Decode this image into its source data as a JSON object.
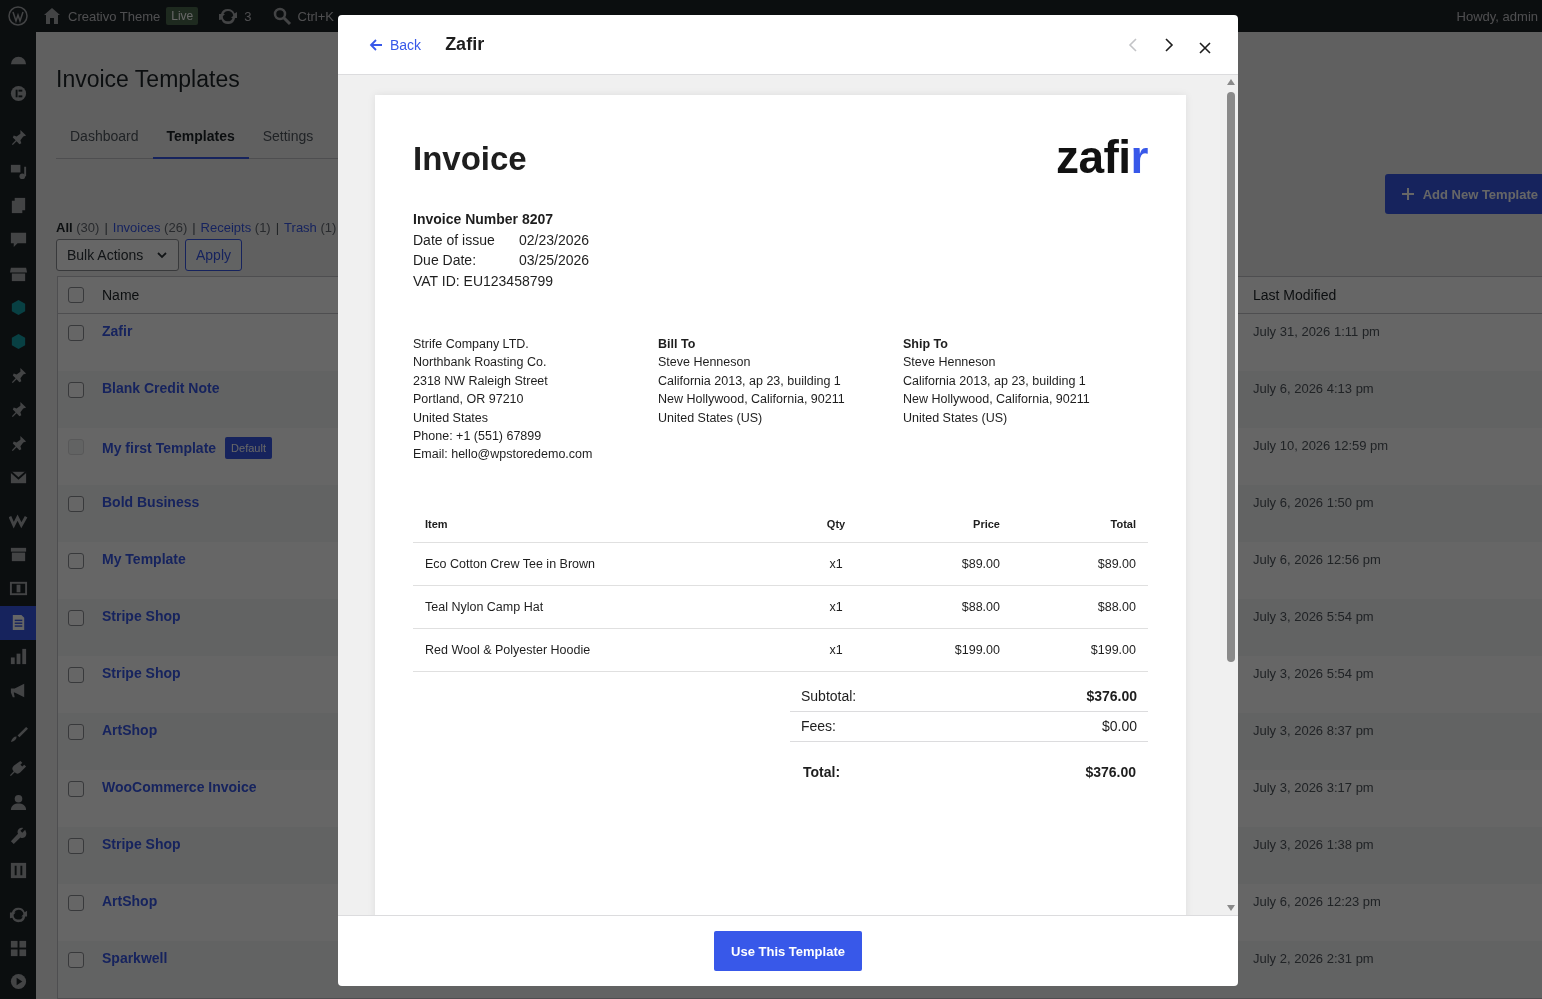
{
  "admin_bar": {
    "site": "Creativo Theme",
    "live_badge": "Live",
    "updates": "3",
    "search_shortcut": "Ctrl+K",
    "greeting": "Howdy, admin"
  },
  "sidebar": {
    "items": [
      {
        "selected": false
      },
      {
        "selected": false
      },
      {
        "selected": false
      },
      {
        "selected": false
      },
      {
        "selected": false
      },
      {
        "selected": false
      },
      {
        "selected": false
      },
      {
        "selected": false
      },
      {
        "selected": false
      },
      {
        "selected": false
      },
      {
        "selected": false
      },
      {
        "selected": false
      },
      {
        "selected": false
      },
      {
        "selected": false
      },
      {
        "selected": false
      },
      {
        "selected": false
      },
      {
        "selected": true
      },
      {
        "selected": false
      },
      {
        "selected": false
      },
      {
        "selected": false
      },
      {
        "selected": false
      },
      {
        "selected": false
      },
      {
        "selected": false
      },
      {
        "selected": false
      },
      {
        "selected": false
      },
      {
        "selected": false
      },
      {
        "selected": false
      }
    ]
  },
  "page": {
    "title": "Invoice Templates",
    "tabs": [
      {
        "label": "Dashboard",
        "selected": false
      },
      {
        "label": "Templates",
        "selected": true
      },
      {
        "label": "Settings",
        "selected": false
      }
    ],
    "add_button": "Add New Template",
    "filter_separator": "|",
    "filters": [
      {
        "label": "All",
        "count": "(30)",
        "selected": true
      },
      {
        "label": "Invoices",
        "count": "(26)",
        "selected": false
      },
      {
        "label": "Receipts",
        "count": "(1)",
        "selected": false
      },
      {
        "label": "Trash",
        "count": "(1)",
        "selected": false
      }
    ],
    "bulk_actions": "Bulk Actions",
    "apply": "Apply",
    "table": {
      "columns": [
        "Name",
        "Last Modified"
      ],
      "header_checked": false,
      "rows": [
        {
          "name": "Zafir",
          "modified": "July 31, 2026 1:11 pm",
          "checked": false,
          "disabled": false
        },
        {
          "name": "Blank Credit Note",
          "modified": "July 6, 2026 4:13 pm",
          "checked": false,
          "disabled": false
        },
        {
          "name": "My first Template",
          "badge": "Default",
          "modified": "July 10, 2026 12:59 pm",
          "checked": false,
          "disabled": true
        },
        {
          "name": "Bold Business",
          "modified": "July 6, 2026 1:50 pm",
          "checked": false,
          "disabled": false
        },
        {
          "name": "My Template",
          "modified": "July 6, 2026 12:56 pm",
          "checked": false,
          "disabled": false
        },
        {
          "name": "Stripe Shop",
          "modified": "July 3, 2026 5:54 pm",
          "checked": false,
          "disabled": false
        },
        {
          "name": "Stripe Shop",
          "modified": "July 3, 2026 5:54 pm",
          "checked": false,
          "disabled": false
        },
        {
          "name": "ArtShop",
          "modified": "July 3, 2026 8:37 pm",
          "checked": false,
          "disabled": false
        },
        {
          "name": "WooCommerce Invoice",
          "modified": "July 3, 2026 3:17 pm",
          "checked": false,
          "disabled": false
        },
        {
          "name": "Stripe Shop",
          "modified": "July 3, 2026 1:38 pm",
          "checked": false,
          "disabled": false
        },
        {
          "name": "ArtShop",
          "modified": "July 6, 2026 12:23 pm",
          "checked": false,
          "disabled": false
        },
        {
          "name": "Sparkwell",
          "modified": "July 2, 2026 2:31 pm",
          "checked": false,
          "disabled": false
        }
      ]
    }
  },
  "modal": {
    "back": "Back",
    "title": "Zafir",
    "prev_disabled": true,
    "next_disabled": false,
    "use_button": "Use This Template",
    "invoice": {
      "title": "Invoice",
      "logo_main": "zafi",
      "logo_accent": "r",
      "number_label": "Invoice Number",
      "number": "8207",
      "dates": [
        {
          "label": "Date of issue",
          "value": "02/23/2026"
        },
        {
          "label": "Due Date:",
          "value": "03/25/2026"
        }
      ],
      "vat": "VAT ID: EU123458799",
      "addresses": [
        {
          "lines": [
            "Strife Company LTD.",
            "Northbank Roasting Co.",
            "2318 NW Raleigh Street",
            "Portland, OR 97210",
            "United States",
            "Phone: +1 (551) 67899",
            "Email: hello@wpstoredemo.com"
          ]
        },
        {
          "heading": "Bill To",
          "lines": [
            "Steve Henneson",
            "California 2013, ap 23, building 1",
            "New Hollywood, California, 90211",
            "United States (US)"
          ]
        },
        {
          "heading": "Ship To",
          "lines": [
            "Steve Henneson",
            "California 2013, ap 23, building 1",
            "New Hollywood, California, 90211",
            "United States (US)"
          ]
        }
      ],
      "columns": [
        "Item",
        "Qty",
        "Price",
        "Total"
      ],
      "items": [
        {
          "item": "Eco Cotton Crew Tee in Brown",
          "qty": "x1",
          "price": "$89.00",
          "total": "$89.00"
        },
        {
          "item": "Teal Nylon Camp Hat",
          "qty": "x1",
          "price": "$88.00",
          "total": "$88.00"
        },
        {
          "item": "Red Wool & Polyester Hoodie",
          "qty": "x1",
          "price": "$199.00",
          "total": "$199.00"
        }
      ],
      "totals": [
        {
          "kind": "subtotal",
          "label": "Subtotal:",
          "value": "$376.00"
        },
        {
          "kind": "fee",
          "label": "Fees:",
          "value": "$0.00"
        },
        {
          "kind": "total",
          "label": "Total:",
          "value": "$376.00"
        }
      ]
    }
  }
}
